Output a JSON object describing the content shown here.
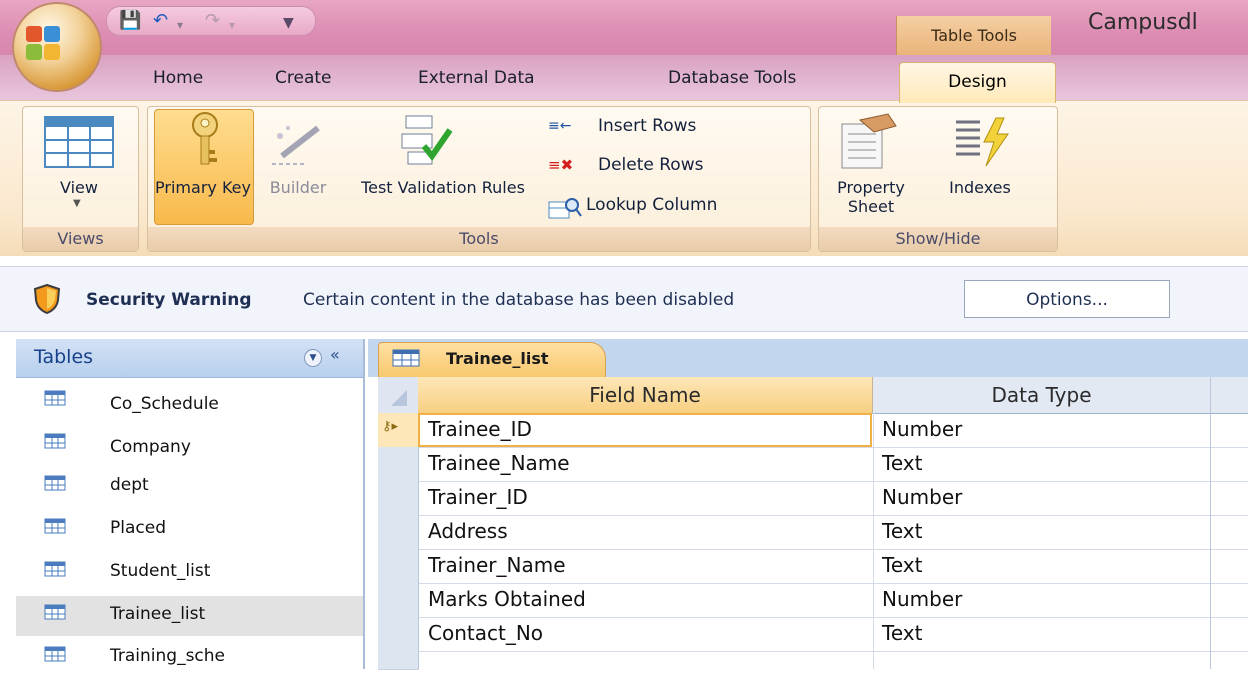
{
  "titlebar": {
    "table_tools": "Table Tools",
    "app_title": "Campusdl"
  },
  "tabs": [
    {
      "label": "Home"
    },
    {
      "label": "Create"
    },
    {
      "label": "External Data"
    },
    {
      "label": "Database Tools"
    },
    {
      "label": "Design"
    }
  ],
  "ribbon": {
    "views_group": {
      "label": "Views",
      "view_label": "View"
    },
    "tools_group": {
      "label": "Tools",
      "primary_key": "Primary Key",
      "builder": "Builder",
      "test_validation": "Test Validation Rules",
      "insert_rows": "Insert Rows",
      "delete_rows": "Delete Rows",
      "lookup_column": "Lookup Column"
    },
    "showhide_group": {
      "label": "Show/Hide",
      "property_sheet": "Property Sheet",
      "indexes": "Indexes"
    }
  },
  "security": {
    "title": "Security Warning",
    "message": "Certain content in the database has been disabled",
    "options": "Options..."
  },
  "nav": {
    "title": "Tables",
    "items": [
      {
        "label": "Co_Schedule"
      },
      {
        "label": "Company"
      },
      {
        "label": "dept"
      },
      {
        "label": "Placed"
      },
      {
        "label": "Student_list"
      },
      {
        "label": "Trainee_list"
      },
      {
        "label": "Training_sche"
      }
    ]
  },
  "document": {
    "tab_label": "Trainee_list",
    "columns": {
      "field": "Field Name",
      "type": "Data Type"
    },
    "rows": [
      {
        "field": "Trainee_ID",
        "type": "Number"
      },
      {
        "field": "Trainee_Name",
        "type": "Text"
      },
      {
        "field": "Trainer_ID",
        "type": "Number"
      },
      {
        "field": "Address",
        "type": "Text"
      },
      {
        "field": "Trainer_Name",
        "type": "Text"
      },
      {
        "field": "Marks Obtained",
        "type": "Number"
      },
      {
        "field": "Contact_No",
        "type": "Text"
      }
    ]
  },
  "colors": {
    "titlebar": "#dd8db3",
    "contextual_tab": "#eab47a",
    "nav_header": "#b8cfed",
    "doc_tab": "#f7c76b"
  }
}
